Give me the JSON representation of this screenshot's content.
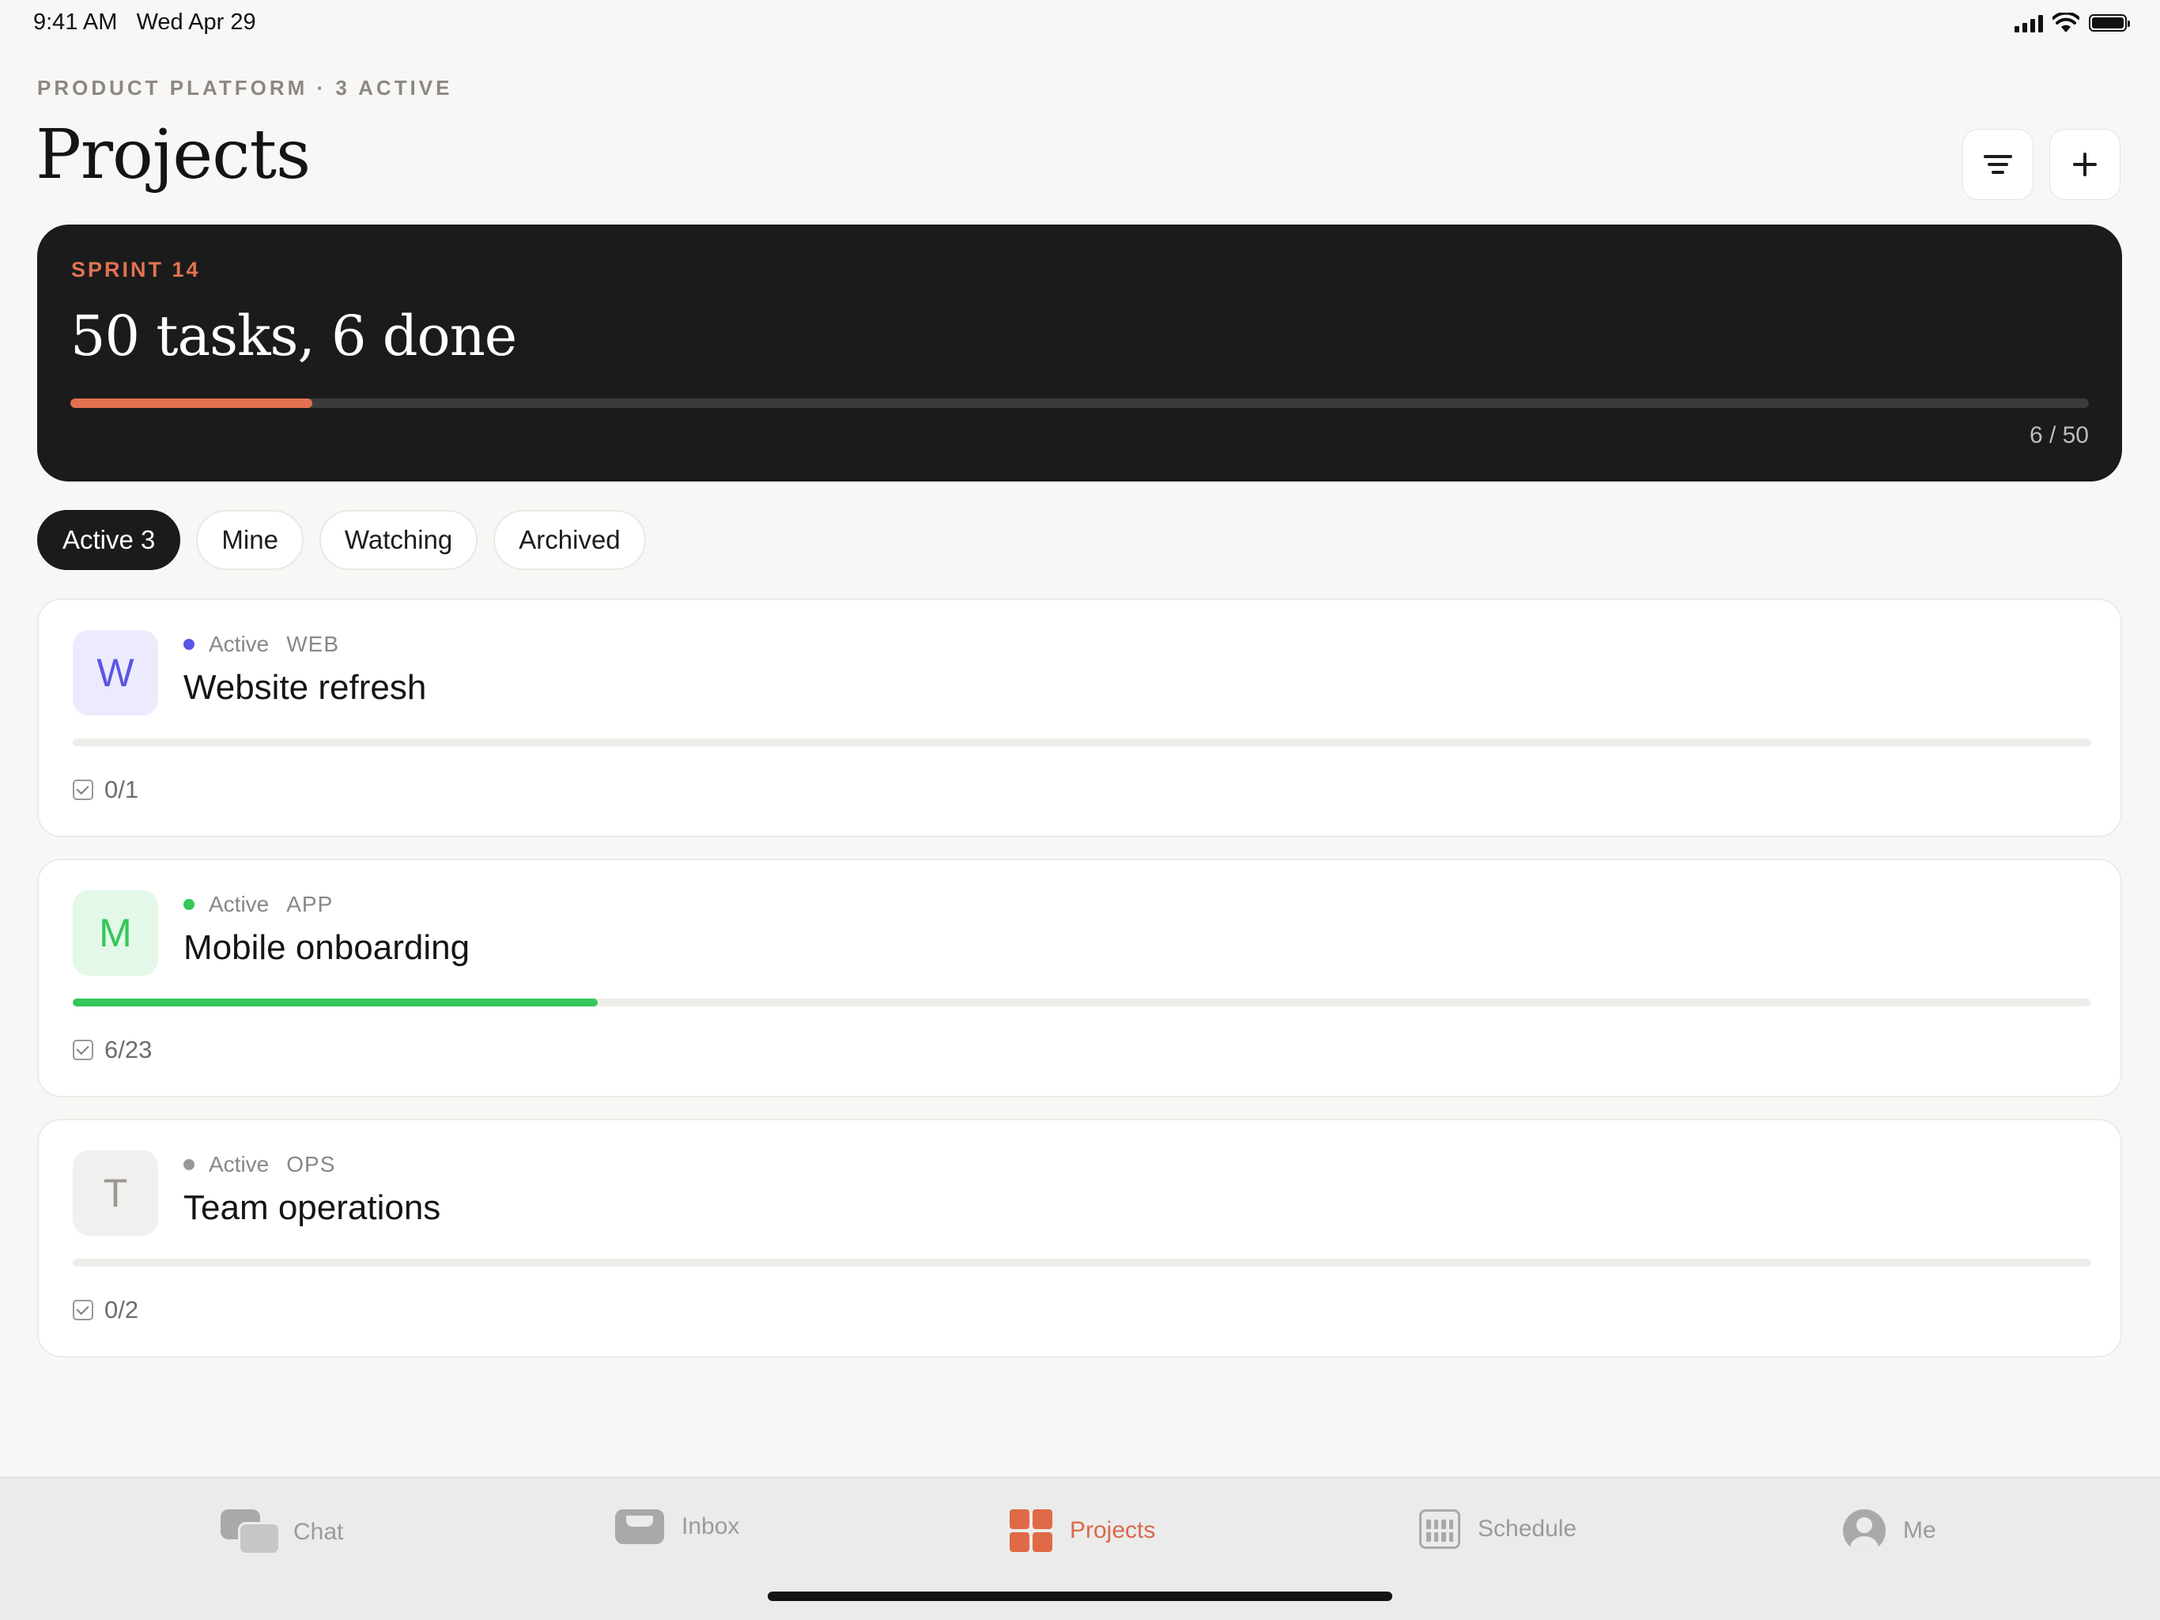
{
  "status_bar": {
    "time": "9:41 AM",
    "date": "Wed Apr 29"
  },
  "header": {
    "eyebrow": "PRODUCT PLATFORM · 3 ACTIVE",
    "title": "Projects",
    "filter_icon": "filter-icon",
    "add_icon": "plus-icon"
  },
  "sprint": {
    "label": "SPRINT 14",
    "title": "50 tasks, 6 done",
    "progress": 0.12,
    "count": "6 / 50",
    "accent": "#e3704f"
  },
  "filters": [
    {
      "label": "Active 3",
      "selected": true
    },
    {
      "label": "Mine",
      "selected": false
    },
    {
      "label": "Watching",
      "selected": false
    },
    {
      "label": "Archived",
      "selected": false
    }
  ],
  "projects": [
    {
      "initial": "W",
      "status": "Active",
      "tag": "WEB",
      "name": "Website refresh",
      "tasks": "0/1",
      "progress": 0,
      "color": "#5b55e6",
      "avatar_bg": "#ecebfd"
    },
    {
      "initial": "M",
      "status": "Active",
      "tag": "APP",
      "name": "Mobile onboarding",
      "tasks": "6/23",
      "progress": 0.26,
      "color": "#34c759",
      "avatar_bg": "#e3f8e8"
    },
    {
      "initial": "T",
      "status": "Active",
      "tag": "OPS",
      "name": "Team operations",
      "tasks": "0/2",
      "progress": 0,
      "color": "#9a9794",
      "avatar_bg": "#f1f0ee"
    }
  ],
  "tabs": [
    {
      "label": "Chat",
      "icon": "chat-icon",
      "active": false
    },
    {
      "label": "Inbox",
      "icon": "inbox-icon",
      "active": false
    },
    {
      "label": "Projects",
      "icon": "projects-grid-icon",
      "active": true
    },
    {
      "label": "Schedule",
      "icon": "calendar-icon",
      "active": false
    },
    {
      "label": "Me",
      "icon": "person-icon",
      "active": false
    }
  ]
}
